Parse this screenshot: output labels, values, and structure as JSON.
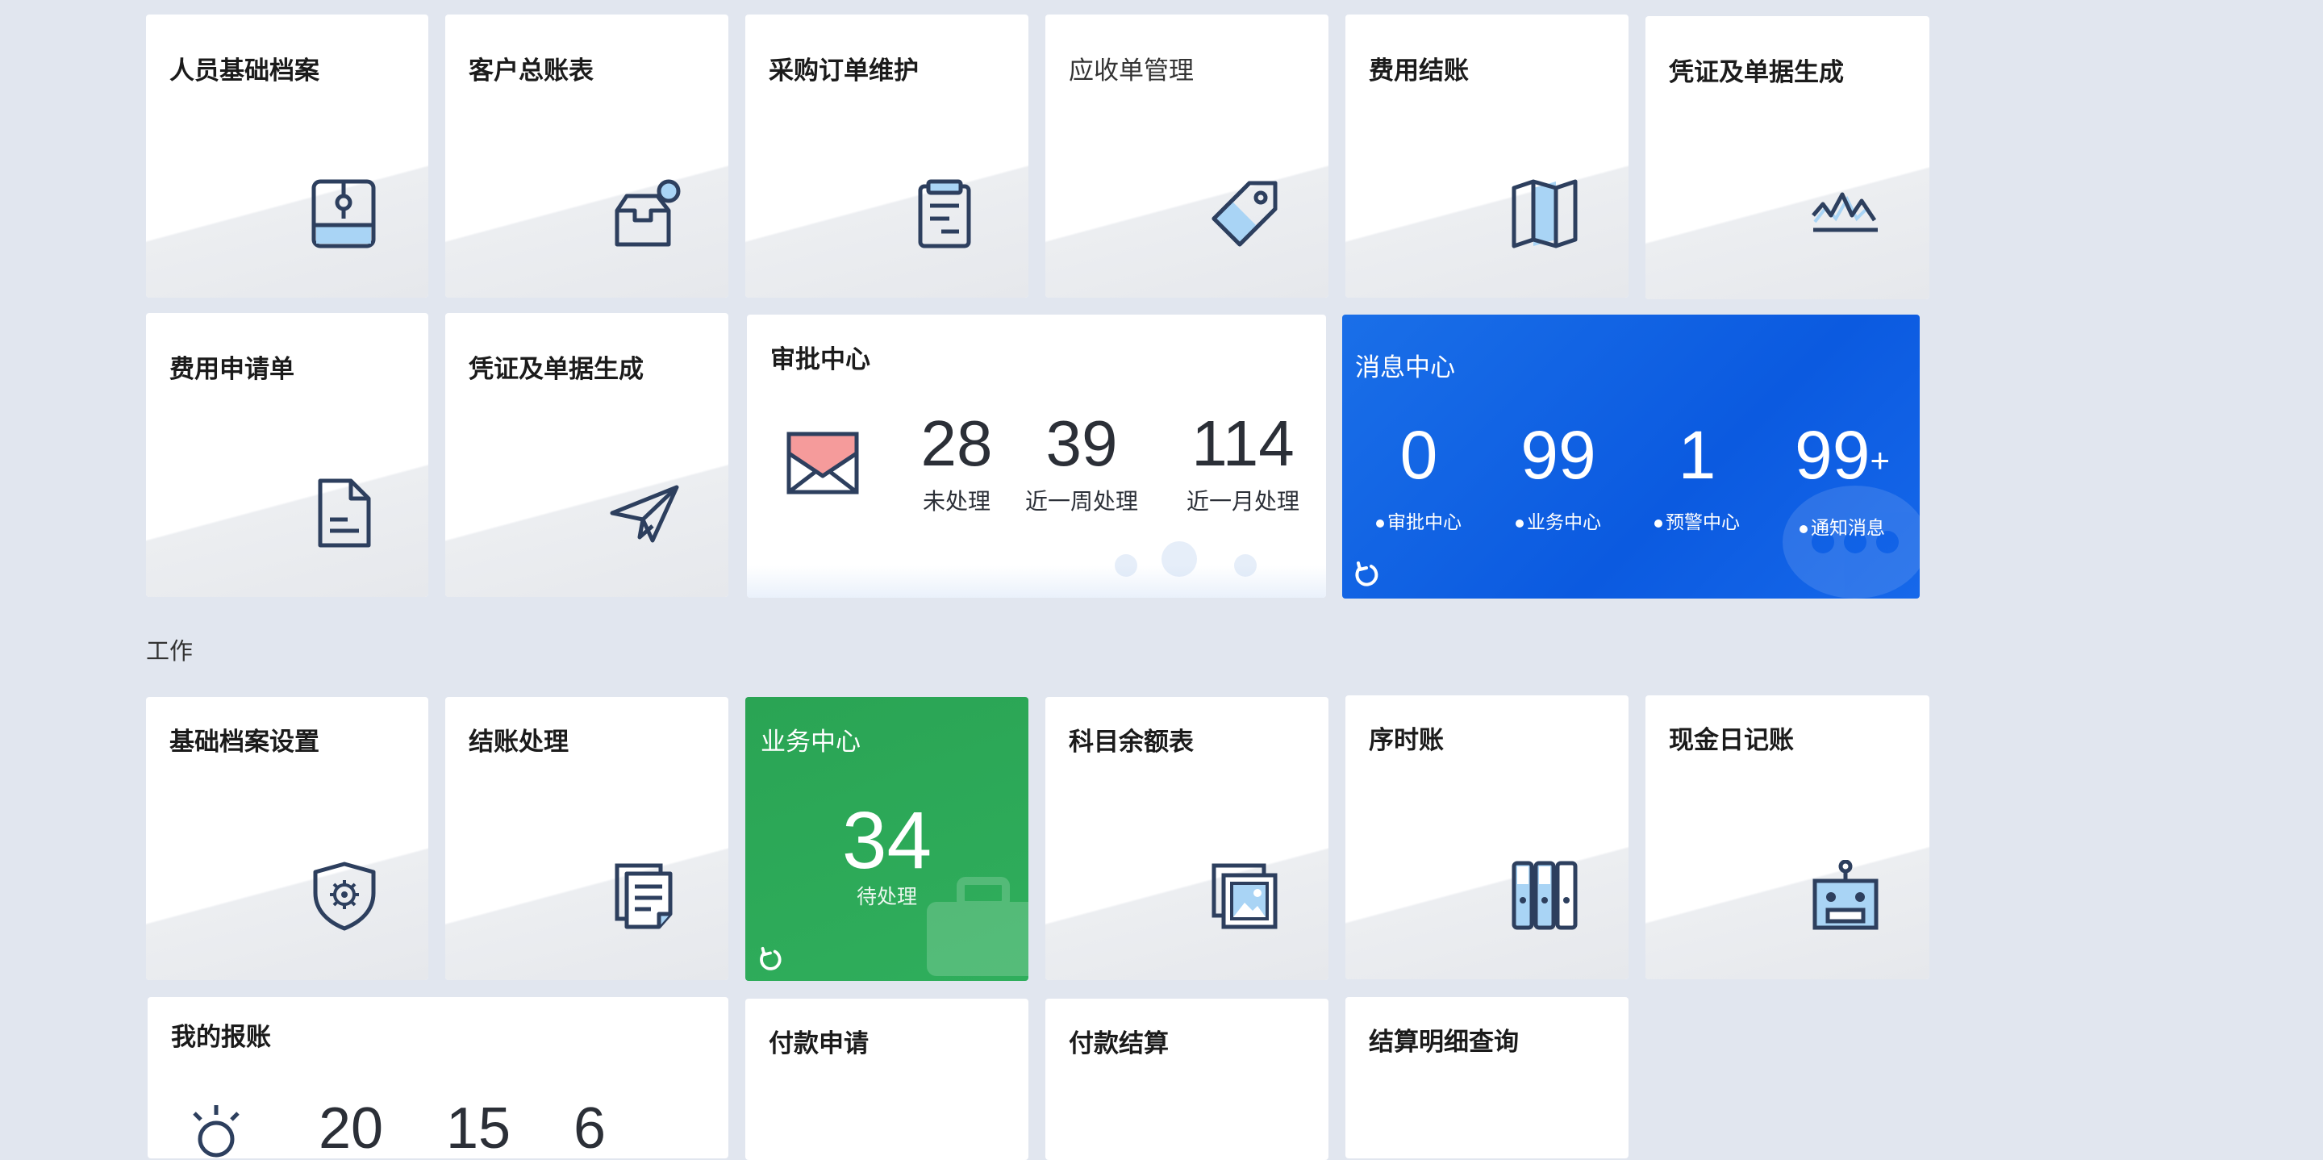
{
  "tiles_row1": [
    {
      "title": "人员基础档案",
      "icon": "archive-box-icon"
    },
    {
      "title": "客户总账表",
      "icon": "inbox-notify-icon"
    },
    {
      "title": "采购订单维护",
      "icon": "clipboard-icon"
    },
    {
      "title": "应收单管理",
      "icon": "tag-icon"
    },
    {
      "title": "费用结账",
      "icon": "map-icon"
    },
    {
      "title": "凭证及单据生成",
      "icon": "line-chart-icon"
    }
  ],
  "tiles_row2": [
    {
      "title": "费用申请单",
      "icon": "document-icon"
    },
    {
      "title": "凭证及单据生成",
      "icon": "paper-plane-icon"
    }
  ],
  "approval": {
    "title": "审批中心",
    "stats": [
      {
        "value": "28",
        "label": "未处理"
      },
      {
        "value": "39",
        "label": "近一周处理"
      },
      {
        "value": "114",
        "label": "近一月处理"
      }
    ]
  },
  "messages": {
    "title": "消息中心",
    "stats": [
      {
        "value": "0",
        "label": "审批中心"
      },
      {
        "value": "99",
        "label": "业务中心"
      },
      {
        "value": "1",
        "label": "预警中心"
      },
      {
        "value": "99",
        "suffix": "+",
        "label": "通知消息"
      }
    ]
  },
  "section": {
    "work_label": "工作"
  },
  "tiles_row3": [
    {
      "title": "基础档案设置",
      "icon": "shield-gear-icon"
    },
    {
      "title": "结账处理",
      "icon": "documents-stack-icon"
    },
    {
      "title": "科目余额表",
      "icon": "image-stack-icon"
    },
    {
      "title": "序时账",
      "icon": "binders-icon"
    },
    {
      "title": "现金日记账",
      "icon": "robot-icon"
    }
  ],
  "business": {
    "title": "业务中心",
    "value": "34",
    "label": "待处理"
  },
  "expense": {
    "title": "我的报账",
    "values": [
      "20",
      "15",
      "6"
    ]
  },
  "tiles_row4": [
    {
      "title": "付款申请"
    },
    {
      "title": "付款结算"
    },
    {
      "title": "结算明细查询"
    }
  ],
  "colors": {
    "accent_blue": "#0b5ae0",
    "accent_green": "#2fae5c",
    "icon_stroke": "#2d3f5e",
    "icon_fill": "#a9d4f5"
  }
}
